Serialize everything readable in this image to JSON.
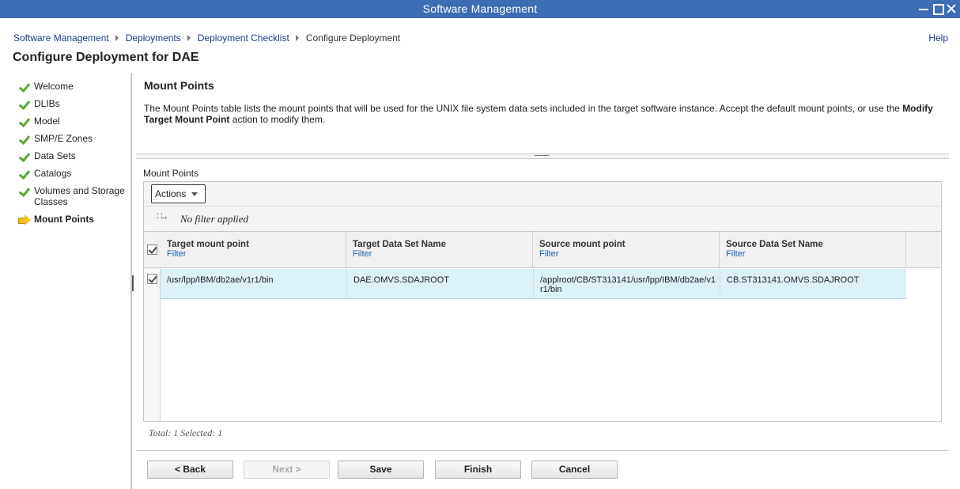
{
  "window": {
    "title": "Software Management"
  },
  "breadcrumb": {
    "items": [
      "Software Management",
      "Deployments",
      "Deployment Checklist"
    ],
    "current": "Configure Deployment"
  },
  "help": "Help",
  "page_title": "Configure Deployment for DAE",
  "nav": {
    "items": [
      {
        "label": "Welcome",
        "status": "complete"
      },
      {
        "label": "DLIBs",
        "status": "complete"
      },
      {
        "label": "Model",
        "status": "complete"
      },
      {
        "label": "SMP/E Zones",
        "status": "complete"
      },
      {
        "label": "Data Sets",
        "status": "complete"
      },
      {
        "label": "Catalogs",
        "status": "complete"
      },
      {
        "label": "Volumes and Storage Classes",
        "status": "complete"
      },
      {
        "label": "Mount Points",
        "status": "current"
      }
    ]
  },
  "section": {
    "title": "Mount Points",
    "desc_pre": "The Mount Points table lists the mount points that will be used for the UNIX file system data sets included in the target software instance.  Accept the default mount points, or use the ",
    "desc_bold": "Modify Target Mount Point",
    "desc_post": " action to modify them."
  },
  "table": {
    "caption": "Mount Points",
    "actions_label": "Actions",
    "filter_status": "No filter applied",
    "columns": [
      {
        "label": "Target mount point",
        "filter": "Filter"
      },
      {
        "label": "Target Data Set Name",
        "filter": "Filter"
      },
      {
        "label": "Source mount point",
        "filter": "Filter"
      },
      {
        "label": "Source Data Set Name",
        "filter": "Filter"
      }
    ],
    "rows": [
      {
        "selected": true,
        "target_mount_point": "/usr/lpp/IBM/db2ae/v1r1/bin",
        "target_data_set_name": "DAE.OMVS.SDAJROOT",
        "source_mount_point": "/applroot/CB/ST313141/usr/lpp/IBM/db2ae/v1r1/bin",
        "source_data_set_name": "CB.ST313141.OMVS.SDAJROOT"
      }
    ],
    "status": "Total: 1 Selected: 1"
  },
  "buttons": {
    "back": "< Back",
    "next": "Next >",
    "save": "Save",
    "finish": "Finish",
    "cancel": "Cancel"
  }
}
